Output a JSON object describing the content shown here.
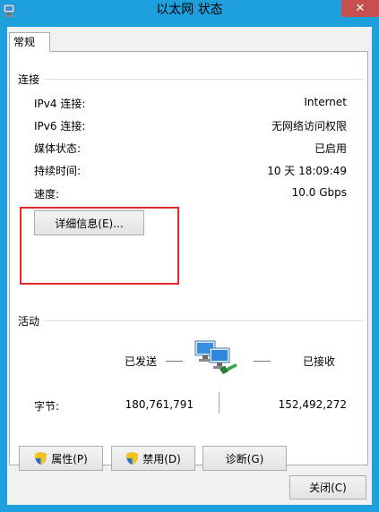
{
  "window": {
    "title": "以太网 状态",
    "close_glyph": "✕"
  },
  "tabs": [
    {
      "label": "常规"
    }
  ],
  "connection": {
    "heading": "连接",
    "rows": [
      {
        "label": "IPv4 连接:",
        "value": "Internet"
      },
      {
        "label": "IPv6 连接:",
        "value": "无网络访问权限"
      },
      {
        "label": "媒体状态:",
        "value": "已启用"
      },
      {
        "label": "持续时间:",
        "value": "10 天 18:09:49"
      },
      {
        "label": "速度:",
        "value": "10.0 Gbps"
      }
    ],
    "details_button": "详细信息(E)..."
  },
  "activity": {
    "heading": "活动",
    "sent_label": "已发送",
    "received_label": "已接收",
    "bytes_label": "字节:",
    "bytes_sent": "180,761,791",
    "bytes_received": "152,492,272"
  },
  "actions": {
    "properties": "属性(P)",
    "disable": "禁用(D)",
    "diagnose": "诊断(G)",
    "close": "关闭(C)"
  },
  "icons": {
    "app": "network-status-icon",
    "network": "network-computers-icon",
    "shield": "uac-shield-icon"
  },
  "colors": {
    "titlebar": "#1ea0dd",
    "close_button": "#c74f50",
    "highlight": "#e62a2a"
  }
}
